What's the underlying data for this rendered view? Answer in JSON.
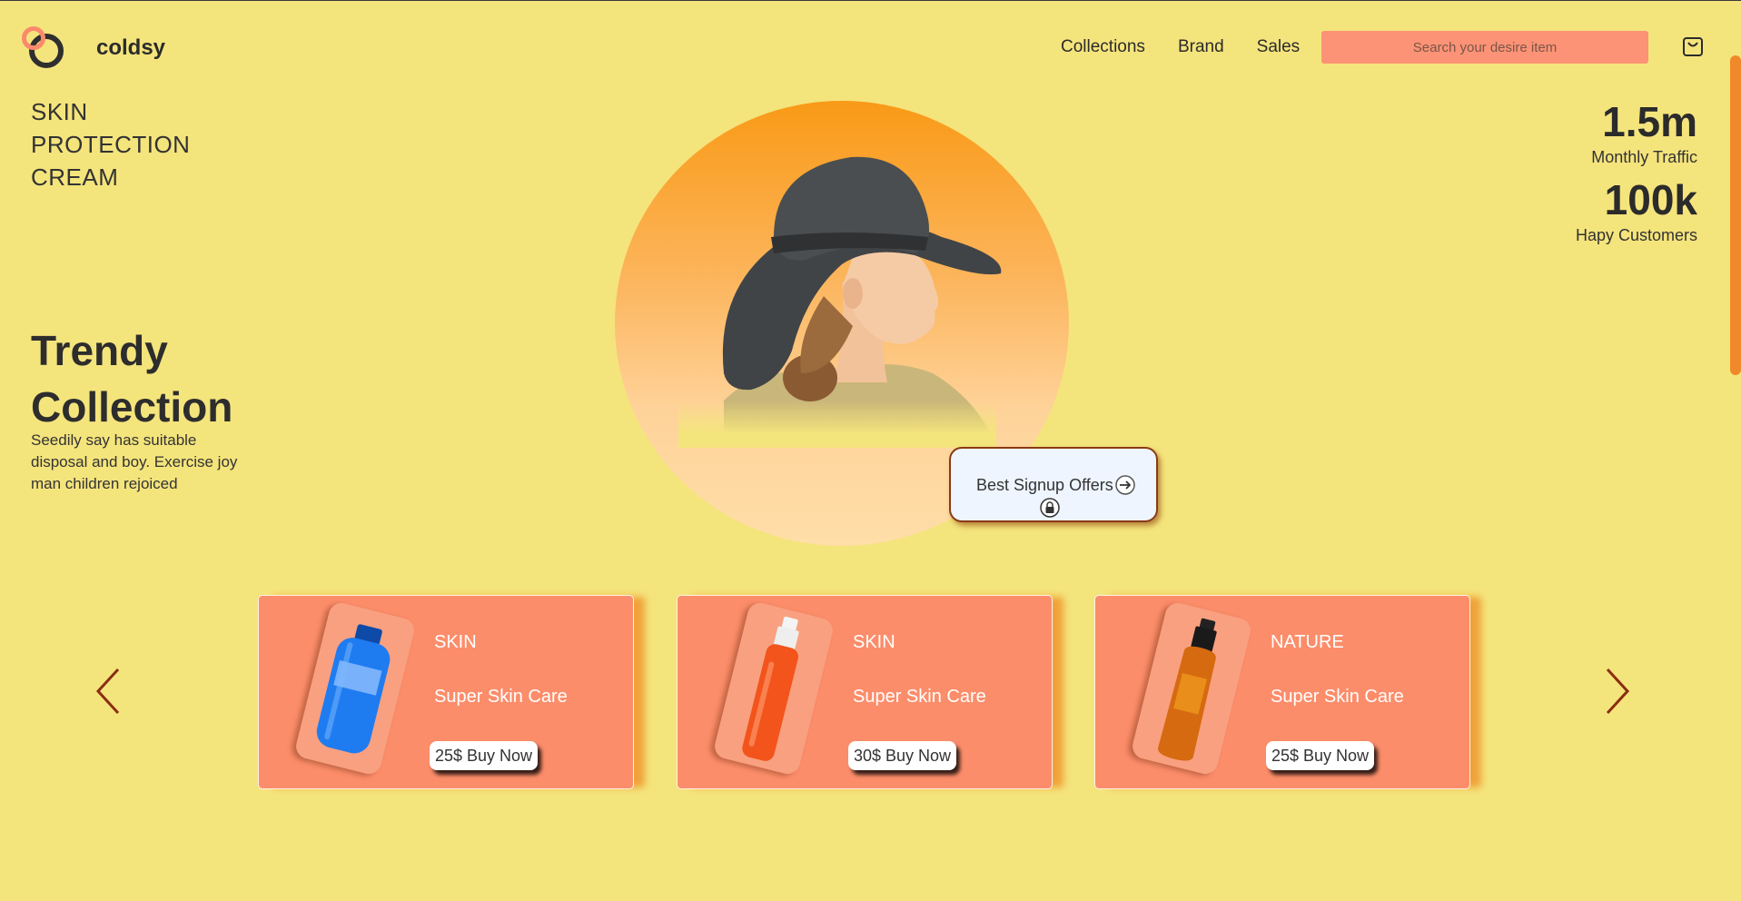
{
  "header": {
    "brand": "coldsy",
    "nav": [
      "Collections",
      "Brand",
      "Sales"
    ],
    "search_placeholder": "Search your desire item"
  },
  "hero": {
    "headline_lines": [
      "SKIN",
      "PROTECTION",
      "CREAM"
    ],
    "trendy_lines": [
      "Trendy",
      "Collection"
    ],
    "description": "Seedily say has suitable disposal and boy. Exercise joy man children rejoiced",
    "signup_label": "Best Signup Offers"
  },
  "stats": [
    {
      "value": "1.5m",
      "label": "Monthly Traffic"
    },
    {
      "value": "100k",
      "label": "Hapy Customers"
    }
  ],
  "products": [
    {
      "category": "SKIN",
      "name": "Super Skin Care",
      "buy_label": "25$ Buy Now",
      "bottle_color": "#1f7cf0"
    },
    {
      "category": "SKIN",
      "name": "Super Skin Care",
      "buy_label": "30$ Buy Now",
      "bottle_color": "#f2541c"
    },
    {
      "category": "NATURE",
      "name": "Super Skin Care",
      "buy_label": "25$ Buy Now",
      "bottle_color": "#d66a10"
    }
  ],
  "colors": {
    "background": "#f4e47c",
    "accent": "#fc8d6a",
    "orange": "#f99a17"
  },
  "icons": [
    "logo-icon",
    "cart-icon",
    "arrow-right-circle-icon",
    "lock-icon",
    "chevron-left-icon",
    "chevron-right-icon"
  ]
}
